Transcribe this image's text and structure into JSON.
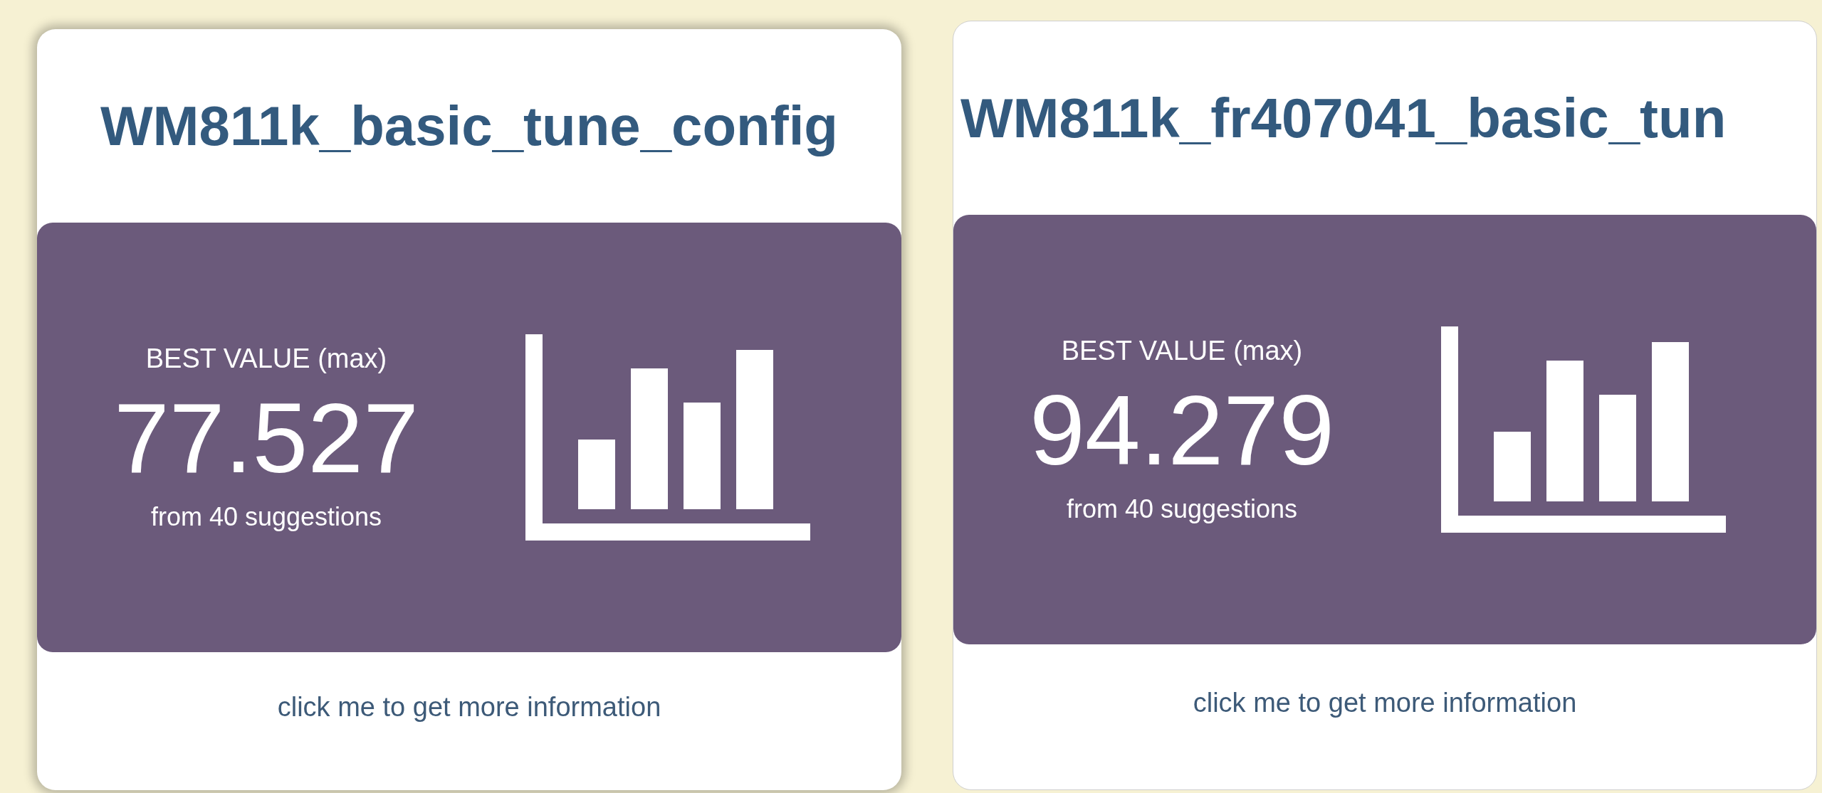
{
  "cards": [
    {
      "title": "WM811k_basic_tune_config",
      "value_label": "BEST VALUE (max)",
      "value": "77.527",
      "caption": "from 40 suggestions",
      "link": "click me to get more information"
    },
    {
      "title": "WM811k_fr407041_basic_tun",
      "value_label": "BEST VALUE (max)",
      "value": "94.279",
      "caption": "from 40 suggestions",
      "link": "click me to get more information"
    }
  ]
}
